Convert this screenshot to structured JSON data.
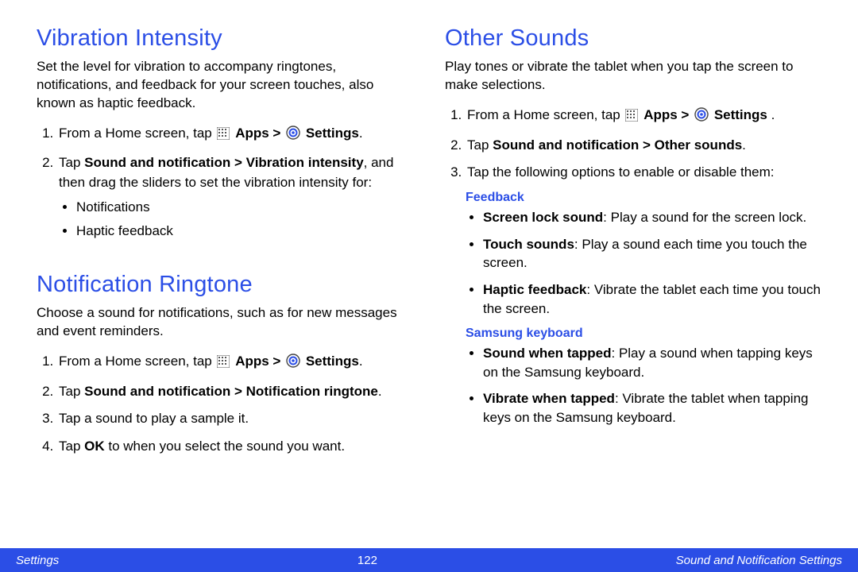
{
  "left": {
    "section1": {
      "title": "Vibration Intensity",
      "intro": "Set the level for vibration to accompany ringtones, notifications, and feedback for your screen touches, also known as haptic feedback.",
      "step1_a": "From a Home screen, tap ",
      "step1_apps": "Apps > ",
      "step1_settings": "Settings",
      "step1_end": ".",
      "step2_a": "Tap ",
      "step2_bold": "Sound and notification > Vibration intensity",
      "step2_b": ", and then drag the sliders to set the vibration intensity for:",
      "bullet1": "Notifications",
      "bullet2": "Haptic feedback"
    },
    "section2": {
      "title": "Notification Ringtone",
      "intro": "Choose a sound for notifications, such as for new messages and event reminders.",
      "step1_a": "From a Home screen, tap ",
      "step1_apps": "Apps > ",
      "step1_settings": "Settings",
      "step1_end": ".",
      "step2_a": "Tap ",
      "step2_bold": "Sound and notification > Notification ringtone",
      "step2_end": ".",
      "step3": "Tap a sound to play a sample it.",
      "step4_a": "Tap ",
      "step4_bold": "OK",
      "step4_b": " to when you select the sound you want."
    }
  },
  "right": {
    "section1": {
      "title": "Other Sounds",
      "intro": "Play tones or vibrate the tablet when you tap the screen to make selections.",
      "step1_a": "From a Home screen, tap ",
      "step1_apps": "Apps > ",
      "step1_settings": "Settings ",
      "step1_end": ".",
      "step2_a": "Tap ",
      "step2_bold": "Sound and notification > Other sounds",
      "step2_end": ".",
      "step3": "Tap the following options to enable or disable them:",
      "sub1": {
        "heading": "Feedback",
        "b1_bold": "Screen lock sound",
        "b1_rest": ": Play a sound for the screen lock.",
        "b2_bold": "Touch sounds",
        "b2_rest": ": Play a sound each time you touch the screen.",
        "b3_bold": "Haptic feedback",
        "b3_rest": ": Vibrate the tablet each time you touch the screen."
      },
      "sub2": {
        "heading": "Samsung keyboard",
        "b1_bold": "Sound when tapped",
        "b1_rest": ": Play a sound when tapping keys on the Samsung keyboard.",
        "b2_bold": "Vibrate when tapped",
        "b2_rest": ": Vibrate the tablet when tapping keys on the Samsung keyboard."
      }
    }
  },
  "footer": {
    "left": "Settings",
    "page": "122",
    "right": "Sound and Notification Settings"
  },
  "icons": {
    "apps": "apps-grid-icon",
    "settings": "settings-gear-icon"
  }
}
